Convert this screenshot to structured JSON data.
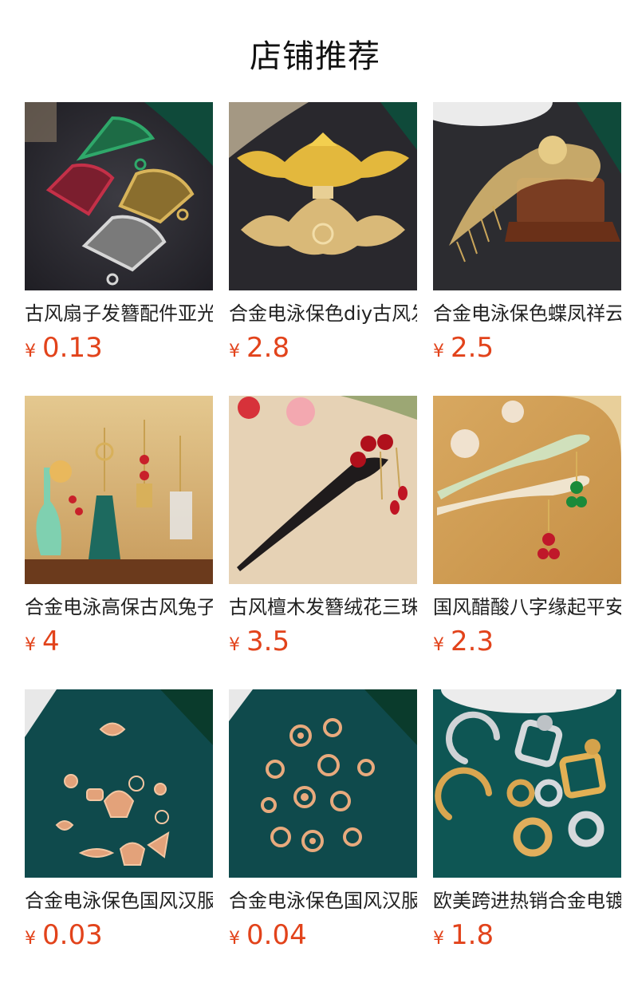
{
  "header": {
    "title": "店铺推荐"
  },
  "products": [
    {
      "name": "古风扇子发簪配件亚光镂空扇形吊坠",
      "currency": "¥",
      "price": "0.13",
      "thumb_icon": "fan-pendant-image"
    },
    {
      "name": "合金电泳保色diy古风发簪配件",
      "currency": "¥",
      "price": "2.8",
      "thumb_icon": "dragon-crown-image"
    },
    {
      "name": "合金电泳保色蝶凤祥云发梳",
      "currency": "¥",
      "price": "2.5",
      "thumb_icon": "hair-comb-image"
    },
    {
      "name": "合金电泳高保古风兔子流苏发簪",
      "currency": "¥",
      "price": "4",
      "thumb_icon": "tassel-pendants-image"
    },
    {
      "name": "古风檀木发簪绒花三珠流苏",
      "currency": "¥",
      "price": "3.5",
      "thumb_icon": "wooden-hairpin-image"
    },
    {
      "name": "国风醋酸八字缘起平安发簪",
      "currency": "¥",
      "price": "2.3",
      "thumb_icon": "acetate-hairpin-image"
    },
    {
      "name": "合金电泳保色国风汉服配件",
      "currency": "¥",
      "price": "0.03",
      "thumb_icon": "gold-charms-image"
    },
    {
      "name": "合金电泳保色国风汉服吊坠",
      "currency": "¥",
      "price": "0.04",
      "thumb_icon": "gold-knots-image"
    },
    {
      "name": "欧美跨进热销合金电镀耳环",
      "currency": "¥",
      "price": "1.8",
      "thumb_icon": "metal-earrings-image"
    }
  ],
  "colors": {
    "price": "#e2431b",
    "title": "#111111",
    "name": "#222222"
  }
}
